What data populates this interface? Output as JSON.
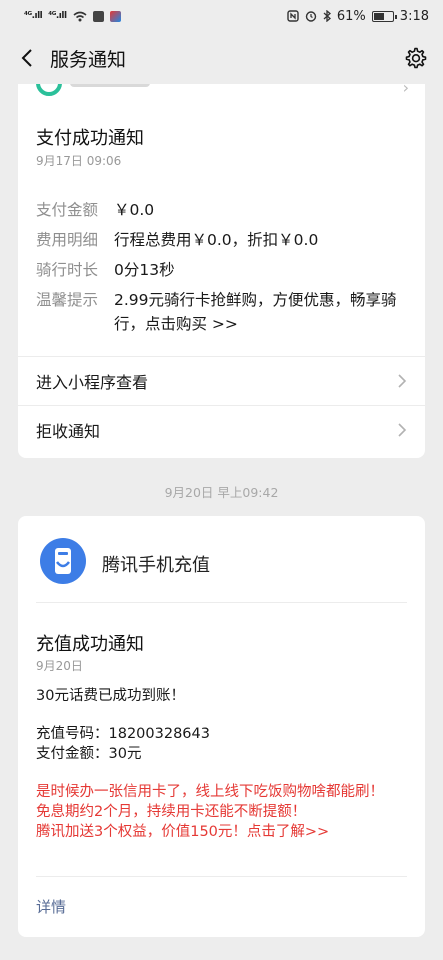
{
  "status_bar": {
    "signal1": "⁴ᴳ.ıll",
    "signal2": "⁴ᴳ.ıll",
    "battery_percent": "61%",
    "battery_level": 0.61,
    "time": "3:18"
  },
  "header": {
    "title": "服务通知",
    "back_icon": "chevron-left-icon",
    "settings_icon": "gear-icon"
  },
  "card1": {
    "title": "支付成功通知",
    "date": "9月17日 09:06",
    "fields": [
      {
        "label": "支付金额",
        "value": "￥0.0"
      },
      {
        "label": "费用明细",
        "value": "行程总费用￥0.0，折扣￥0.0"
      },
      {
        "label": "骑行时长",
        "value": "0分13秒"
      },
      {
        "label": "温馨提示",
        "value": "2.99元骑行卡抢鲜购，方便优惠，畅享骑行，点击购买 >>"
      }
    ],
    "link_mini_program": "进入小程序查看",
    "link_reject": "拒收通知"
  },
  "timestamp": "9月20日 早上09:42",
  "card2": {
    "service_name": "腾讯手机充值",
    "title": "充值成功通知",
    "date": "9月20日",
    "message": "30元话费已成功到账！",
    "recharge_number": "充值号码：18200328643",
    "pay_amount": "支付金额：30元",
    "promo_line1": "是时候办一张信用卡了，线上线下吃饭购物啥都能刷！",
    "promo_line2": "免息期约2个月，持续用卡还能不断提额！",
    "promo_line3": "腾讯加送3个权益，价值150元！点击了解>>",
    "details_label": "详情"
  },
  "colors": {
    "background": "#ededed",
    "card": "#ffffff",
    "promo_red": "#e53935",
    "link_blue": "#576b95",
    "label_gray": "#8f8f8f",
    "brand_blue": "#3d7de6",
    "brand_green": "#2bc09a"
  }
}
